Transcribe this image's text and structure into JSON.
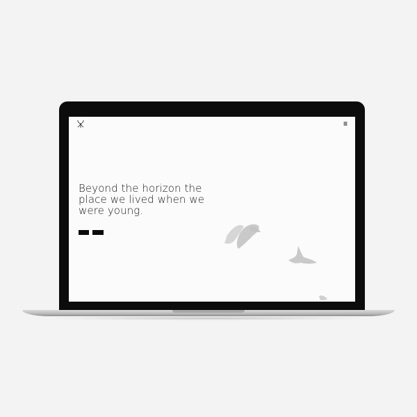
{
  "hero": {
    "headline": "Beyond the horizon the place we lived when we were young.",
    "buttons": [
      {
        "label": ""
      },
      {
        "label": ""
      }
    ]
  },
  "header": {
    "logo_icon": "crossed-arrows-logo",
    "menu_icon": "hamburger-menu-icon"
  },
  "background": {
    "image_subject": "birds-in-flight",
    "screen_color": "#fbfbfb",
    "bezel_color": "#0c0c0c",
    "page_color": "#f3f3f3"
  }
}
